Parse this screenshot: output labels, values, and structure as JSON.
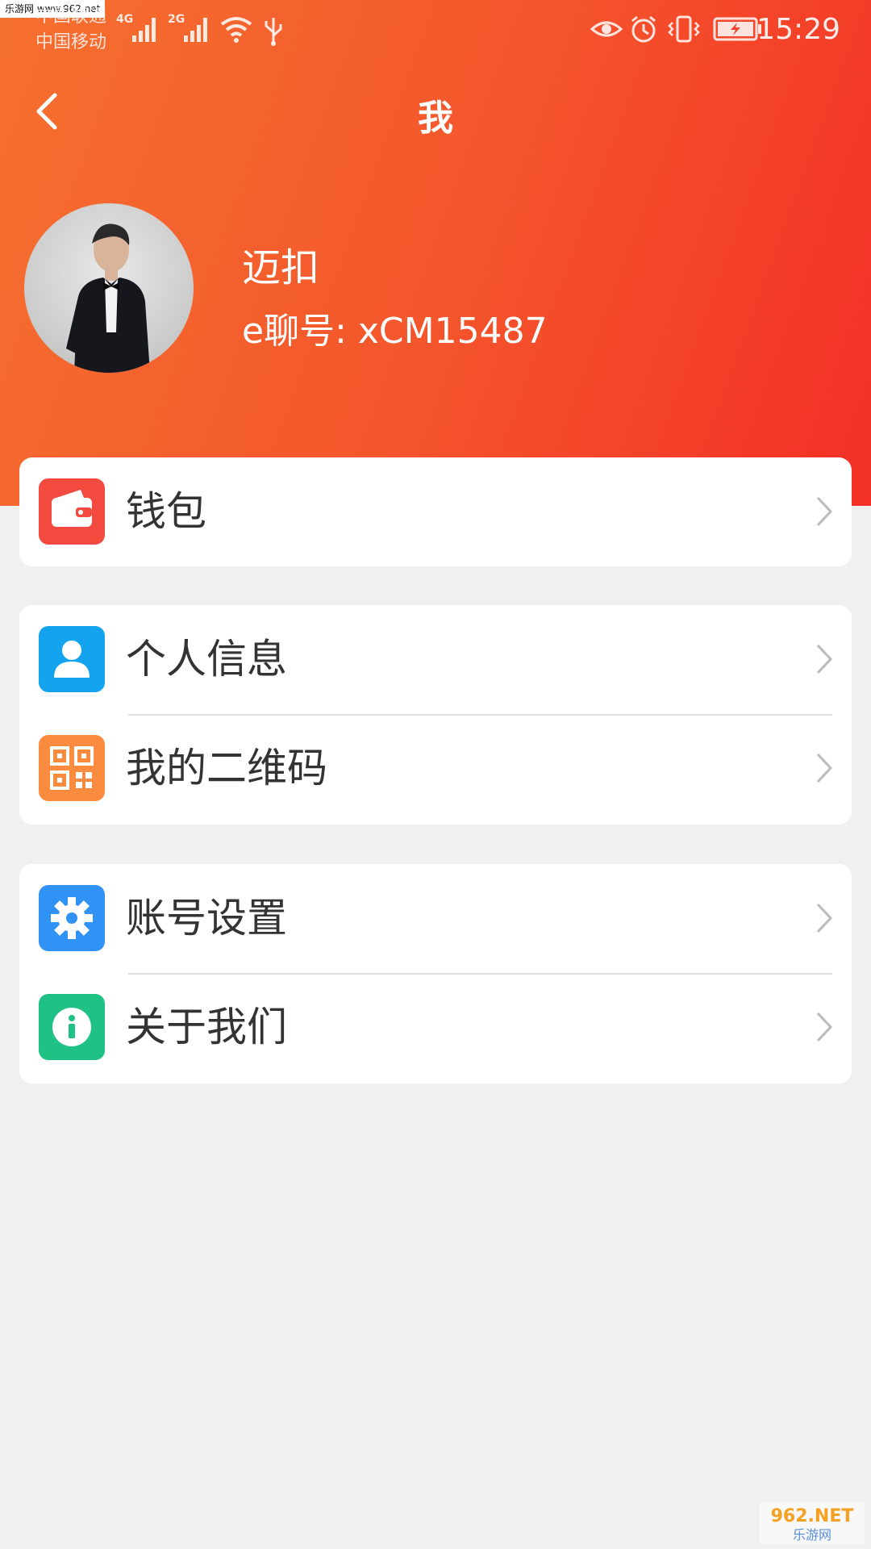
{
  "status_bar": {
    "watermark": "乐游网 www.962.net",
    "carrier_1": "中国联通",
    "carrier_2": "中国移动",
    "network_1": "4G",
    "network_2": "2G",
    "time": "15:29"
  },
  "nav": {
    "title": "我"
  },
  "profile": {
    "name": "迈扣",
    "echat_id": "e聊号: xCM15487"
  },
  "menu": {
    "wallet": {
      "label": "钱包",
      "icon": "wallet-icon",
      "color": "#f24a3e"
    },
    "personal_info": {
      "label": "个人信息",
      "icon": "person-icon",
      "color": "#14a4ef"
    },
    "qr_code": {
      "label": "我的二维码",
      "icon": "qr-code-icon",
      "color": "#fb8b3f"
    },
    "account_settings": {
      "label": "账号设置",
      "icon": "gear-icon",
      "color": "#2f92f4"
    },
    "about_us": {
      "label": "关于我们",
      "icon": "info-icon",
      "color": "#1fc184"
    }
  },
  "watermark_bottom": {
    "top": "962.NET",
    "bottom": "乐游网"
  },
  "colors": {
    "header_start": "#f5702f",
    "header_end": "#f32f26",
    "background": "#f0f0f0"
  }
}
